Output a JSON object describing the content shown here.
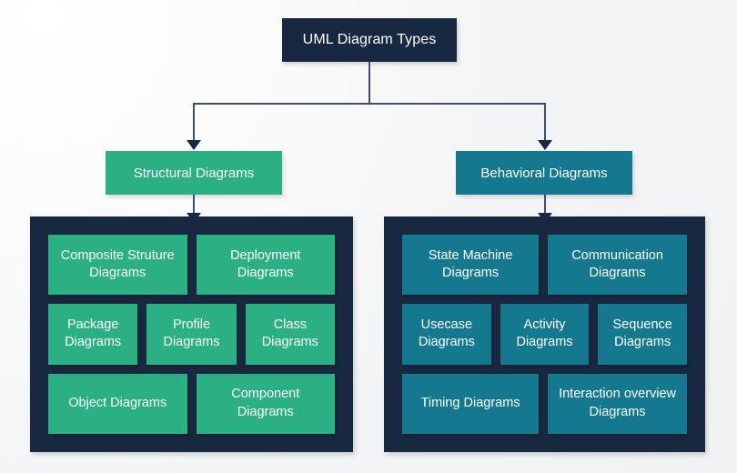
{
  "title": "UML Diagram Types",
  "colors": {
    "background": "#f4f5f6",
    "dark_navy": "#192841",
    "green": "#2bb083",
    "teal": "#14798f",
    "connector": "#404f66",
    "text": "#ffffff"
  },
  "root": {
    "label": "UML Diagram Types"
  },
  "categories": {
    "structural": {
      "label": "Structural Diagrams",
      "color": "#2bb083"
    },
    "behavioral": {
      "label": "Behavioral Diagrams",
      "color": "#14798f"
    }
  },
  "structural_panel": {
    "rows": [
      {
        "items": [
          {
            "label": "Composite Struture Diagrams"
          },
          {
            "label": "Deployment Diagrams"
          }
        ]
      },
      {
        "items": [
          {
            "label": "Package Diagrams"
          },
          {
            "label": "Profile Diagrams"
          },
          {
            "label": "Class Diagrams"
          }
        ]
      },
      {
        "items": [
          {
            "label": "Object Diagrams"
          },
          {
            "label": "Component Diagrams"
          }
        ]
      }
    ]
  },
  "behavioral_panel": {
    "rows": [
      {
        "items": [
          {
            "label": "State Machine Diagrams"
          },
          {
            "label": "Communication Diagrams"
          }
        ]
      },
      {
        "items": [
          {
            "label": "Usecase Diagrams"
          },
          {
            "label": "Activity Diagrams"
          },
          {
            "label": "Sequence Diagrams"
          }
        ]
      },
      {
        "items": [
          {
            "label": "Timing Diagrams"
          },
          {
            "label": "Interaction overview Diagrams"
          }
        ]
      }
    ]
  }
}
